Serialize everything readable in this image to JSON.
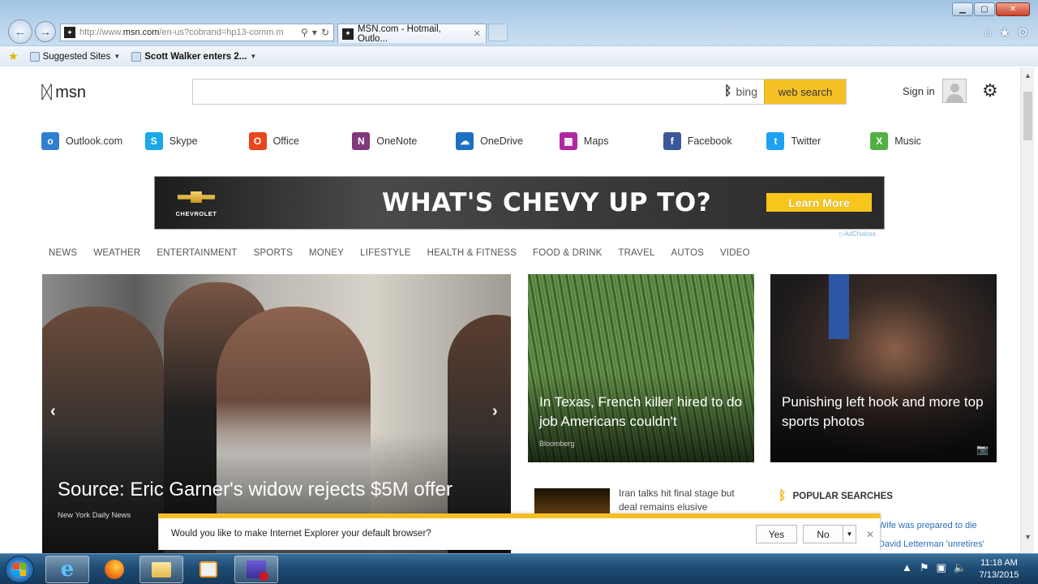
{
  "browser": {
    "address_url_prefix": "http://www.",
    "address_url_domain": "msn.com",
    "address_url_rest": "/en-us?cobrand=hp13-comm.m",
    "tab_title": "MSN.com - Hotmail, Outlo...",
    "favorites": [
      {
        "label": "Suggested Sites"
      },
      {
        "label": "Scott Walker enters 2..."
      }
    ]
  },
  "header": {
    "logo_text": "msn",
    "search_placeholder": "",
    "bing_label": "bing",
    "web_search_label": "web search",
    "sign_in_label": "Sign in"
  },
  "apps": [
    {
      "label": "Outlook.com",
      "icon": "outlook-icon",
      "glyph": "o",
      "color": "#2f7fd0"
    },
    {
      "label": "Skype",
      "icon": "skype-icon",
      "glyph": "S",
      "color": "#19a9e6"
    },
    {
      "label": "Office",
      "icon": "office-icon",
      "glyph": "O",
      "color": "#e8471e"
    },
    {
      "label": "OneNote",
      "icon": "onenote-icon",
      "glyph": "N",
      "color": "#80397b"
    },
    {
      "label": "OneDrive",
      "icon": "onedrive-icon",
      "glyph": "☁",
      "color": "#1d6fc2"
    },
    {
      "label": "Maps",
      "icon": "maps-icon",
      "glyph": "▦",
      "color": "#b0289f"
    },
    {
      "label": "Facebook",
      "icon": "facebook-icon",
      "glyph": "f",
      "color": "#3b5998"
    },
    {
      "label": "Twitter",
      "icon": "twitter-icon",
      "glyph": "t",
      "color": "#1da1f2"
    },
    {
      "label": "Music",
      "icon": "xbox-music-icon",
      "glyph": "X",
      "color": "#52b043"
    }
  ],
  "ad": {
    "brand": "CHEVROLET",
    "headline": "WHAT'S CHEVY UP TO?",
    "cta": "Learn More",
    "adchoices": "AdChoices"
  },
  "nav": [
    "NEWS",
    "WEATHER",
    "ENTERTAINMENT",
    "SPORTS",
    "MONEY",
    "LIFESTYLE",
    "HEALTH & FITNESS",
    "FOOD & DRINK",
    "TRAVEL",
    "AUTOS",
    "VIDEO"
  ],
  "hero": {
    "title": "Source: Eric Garner's widow rejects $5M offer",
    "source": "New York Daily News"
  },
  "cards": [
    {
      "title": "In Texas, French killer hired to do job Americans couldn't",
      "source": "Bloomberg"
    },
    {
      "title": "Punishing left hook and more top sports photos",
      "source": ""
    }
  ],
  "news_item": {
    "title": "Iran talks hit final stage but deal remains elusive"
  },
  "popular": {
    "heading": "POPULAR SEARCHES",
    "links": [
      "Wife was prepared to die",
      "David Letterman 'unretires'"
    ]
  },
  "notification": {
    "message": "Would you like to make Internet Explorer your default browser?",
    "yes": "Yes",
    "no": "No"
  },
  "taskbar": {
    "time": "11:18 AM",
    "date": "7/13/2015"
  },
  "colors": {
    "accent_yellow": "#f5c026",
    "link_blue": "#2a6ebb"
  }
}
